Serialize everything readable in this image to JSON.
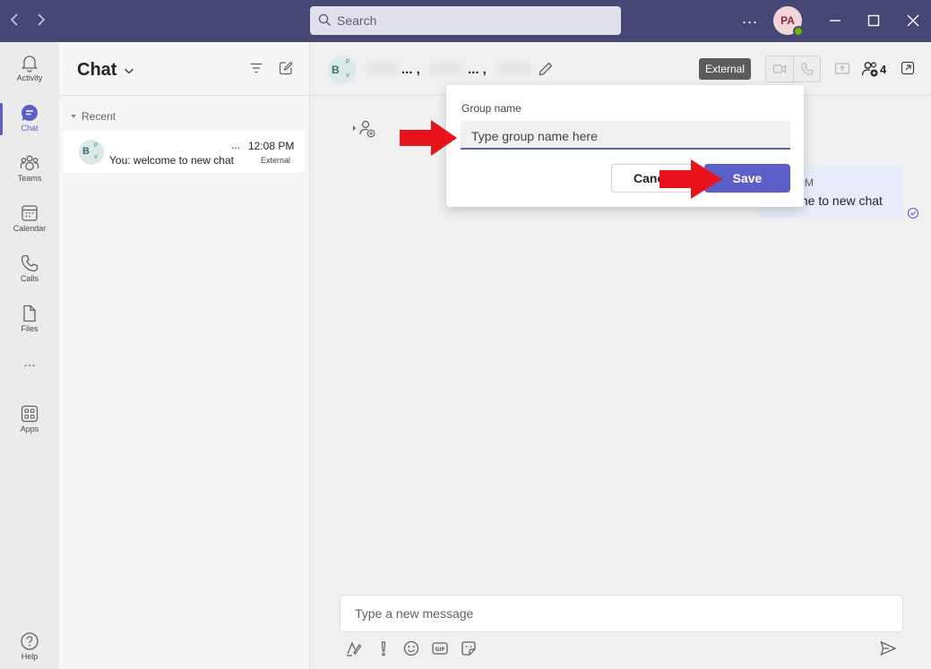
{
  "titlebar": {
    "search_placeholder": "Search",
    "more": "...",
    "avatar_initials": "PA"
  },
  "rail": {
    "items": [
      {
        "label": "Activity",
        "icon": "bell-icon"
      },
      {
        "label": "Chat",
        "icon": "chat-icon"
      },
      {
        "label": "Teams",
        "icon": "teams-icon"
      },
      {
        "label": "Calendar",
        "icon": "calendar-icon"
      },
      {
        "label": "Calls",
        "icon": "phone-icon"
      },
      {
        "label": "Files",
        "icon": "file-icon"
      },
      {
        "label": "Apps",
        "icon": "apps-icon"
      },
      {
        "label": "Help",
        "icon": "help-icon"
      }
    ],
    "more": "..."
  },
  "chatlist": {
    "title": "Chat",
    "recent_label": "Recent",
    "items": [
      {
        "avatar": "B",
        "avatar_p": "P",
        "avatar_v": "V",
        "dots": "...",
        "time": "12:08 PM",
        "preview": "You: welcome to new chat",
        "tag": "External"
      }
    ]
  },
  "main": {
    "header": {
      "avatar": "B",
      "avatar_p": "P",
      "avatar_v": "V",
      "name_1": "... ,",
      "name_2": "... ,",
      "external_label": "External",
      "participants_count": "4"
    },
    "message": {
      "time_fragment": "PM",
      "text_fragment": "me to new chat"
    },
    "composer_placeholder": "Type a new message"
  },
  "popup": {
    "label": "Group name",
    "input_placeholder": "Type group name here",
    "cancel_label": "Cancel",
    "save_label": "Save"
  },
  "colors": {
    "titlebar": "#464775",
    "accent": "#5b5fc7",
    "annotation_arrow": "#e8141c"
  }
}
